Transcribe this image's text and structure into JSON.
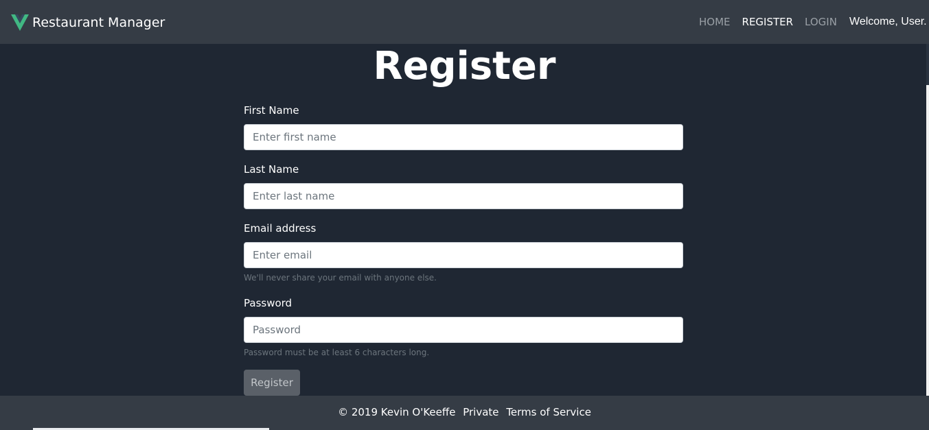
{
  "navbar": {
    "brand": "Restaurant Manager",
    "links": [
      {
        "label": "HOME"
      },
      {
        "label": "REGISTER"
      },
      {
        "label": "LOGIN"
      }
    ],
    "welcome": "Welcome, User."
  },
  "page": {
    "title": "Register"
  },
  "form": {
    "first_name": {
      "label": "First Name",
      "placeholder": "Enter first name",
      "value": ""
    },
    "last_name": {
      "label": "Last Name",
      "placeholder": "Enter last name",
      "value": ""
    },
    "email": {
      "label": "Email address",
      "placeholder": "Enter email",
      "value": "",
      "help": "We'll never share your email with anyone else."
    },
    "password": {
      "label": "Password",
      "placeholder": "Password",
      "value": "",
      "help": "Password must be at least 6 characters long."
    },
    "submit_label": "Register"
  },
  "footer": {
    "copyright": "© 2019 Kevin O'Keeffe",
    "privacy": "Private",
    "terms": "Terms of Service"
  },
  "icons": {
    "brand": "vue-logo-icon"
  },
  "colors": {
    "navbar_bg": "#353c45",
    "page_bg": "#1f2733",
    "brand_accent": "#41b883",
    "button_bg": "#5a6068"
  }
}
